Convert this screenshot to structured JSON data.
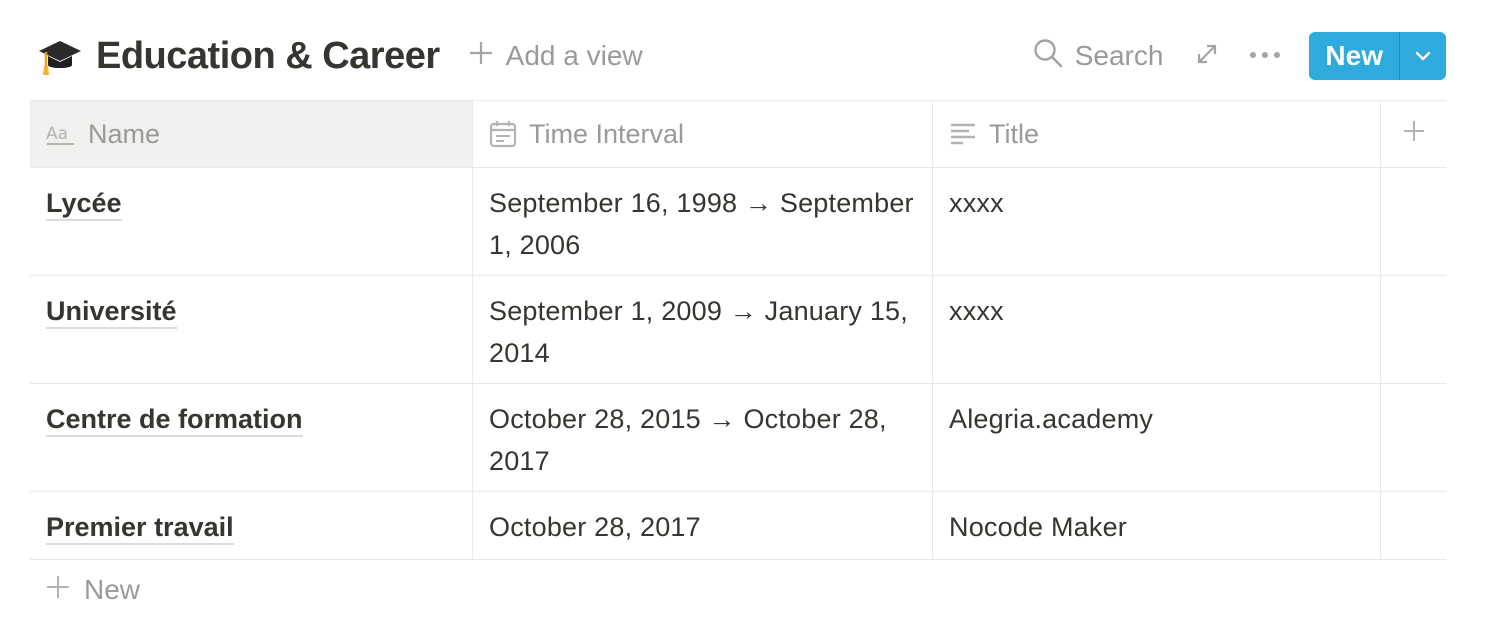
{
  "header": {
    "icon": "graduation-cap-icon",
    "title": "Education & Career",
    "add_view_label": "Add a view",
    "search_label": "Search",
    "new_label": "New",
    "accent_color": "#2eaadc"
  },
  "table": {
    "columns": [
      {
        "label": "Name",
        "icon": "text-property-icon"
      },
      {
        "label": "Time Interval",
        "icon": "calendar-icon"
      },
      {
        "label": "Title",
        "icon": "text-lines-icon"
      }
    ],
    "rows": [
      {
        "name": "Lycée",
        "time_interval": "September 16, 1998 → September 1, 2006",
        "title": "xxxx"
      },
      {
        "name": "Université",
        "time_interval": "September 1, 2009 → January 15, 2014",
        "title": "xxxx"
      },
      {
        "name": "Centre de formation",
        "time_interval": "October 28, 2015 → October 28, 2017",
        "title": "Alegria.academy"
      },
      {
        "name": "Premier travail",
        "time_interval": "October 28, 2017",
        "title": "Nocode Maker"
      }
    ],
    "add_row_label": "New"
  }
}
